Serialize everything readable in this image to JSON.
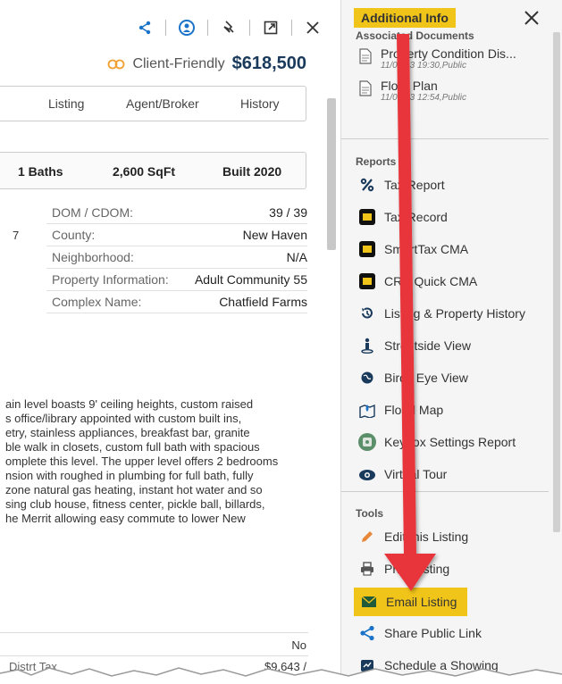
{
  "header": {
    "client_friendly_label": "Client-Friendly",
    "price": "$618,500"
  },
  "tabs": [
    "Listing",
    "Agent/Broker",
    "History"
  ],
  "stats": {
    "baths": "1 Baths",
    "sqft": "2,600 SqFt",
    "built": "Built 2020"
  },
  "details": [
    {
      "key": "DOM / CDOM:",
      "value": "39 / 39"
    },
    {
      "key": "County:",
      "value": "New Haven"
    },
    {
      "key": "Neighborhood:",
      "value": "N/A"
    },
    {
      "key": "Property Information:",
      "value": "Adult Community 55"
    },
    {
      "key": "Complex Name:",
      "value": "Chatfield Farms"
    }
  ],
  "left_fragment": "7",
  "description_lines": [
    "ain level boasts 9' ceiling heights, custom raised",
    "s office/library appointed with custom built ins,",
    "etry, stainless appliances, breakfast bar, granite",
    "ble walk in closets, custom full bath with spacious",
    "omplete this level. The upper level offers 2 bedrooms",
    "nsion with roughed in plumbing for full bath, fully",
    " zone natural gas heating, instant hot water and so",
    "sing club house, fitness center, pickle ball, billards,",
    "he Merrit allowing easy commute to lower New"
  ],
  "bottom": {
    "no_value": "No",
    "tax_label": "Distrt Tax",
    "tax_value": "$9,643 /"
  },
  "panel": {
    "title": "Additional Info",
    "docs_label": "Associated Documents",
    "documents": [
      {
        "name": "Property Condition Dis...",
        "meta": "11/03/23 19:30,Public"
      },
      {
        "name": "Floor Plan",
        "meta": "11/03/23 12:54,Public"
      }
    ],
    "reports_label": "Reports",
    "reports": [
      {
        "label": "Tax Report",
        "icon": "percent-icon"
      },
      {
        "label": "Tax Record",
        "icon": "tax-record-icon"
      },
      {
        "label": "SmartTax CMA",
        "icon": "smarttax-icon"
      },
      {
        "label": "CRS Quick CMA",
        "icon": "crs-icon"
      },
      {
        "label": "Listing & Property History",
        "icon": "history-icon"
      },
      {
        "label": "Streetside View",
        "icon": "streetside-icon"
      },
      {
        "label": "Birds Eye View",
        "icon": "globe-icon"
      },
      {
        "label": "Flood Map",
        "icon": "flood-icon"
      },
      {
        "label": "Keybox Settings Report",
        "icon": "keybox-icon"
      },
      {
        "label": "Virtual Tour",
        "icon": "camera-icon"
      }
    ],
    "tools_label": "Tools",
    "tools": [
      {
        "label": "Edit this Listing",
        "icon": "pencil-icon"
      },
      {
        "label": "Print Listing",
        "icon": "printer-icon"
      },
      {
        "label": "Email Listing",
        "icon": "envelope-icon"
      },
      {
        "label": "Share Public Link",
        "icon": "share-icon"
      },
      {
        "label": "Schedule a Showing",
        "icon": "calendar-icon"
      }
    ]
  },
  "colors": {
    "accent": "#f0c419",
    "arrow": "#e8353a",
    "price": "#1a3a5c",
    "link_blue": "#1a73c8"
  }
}
